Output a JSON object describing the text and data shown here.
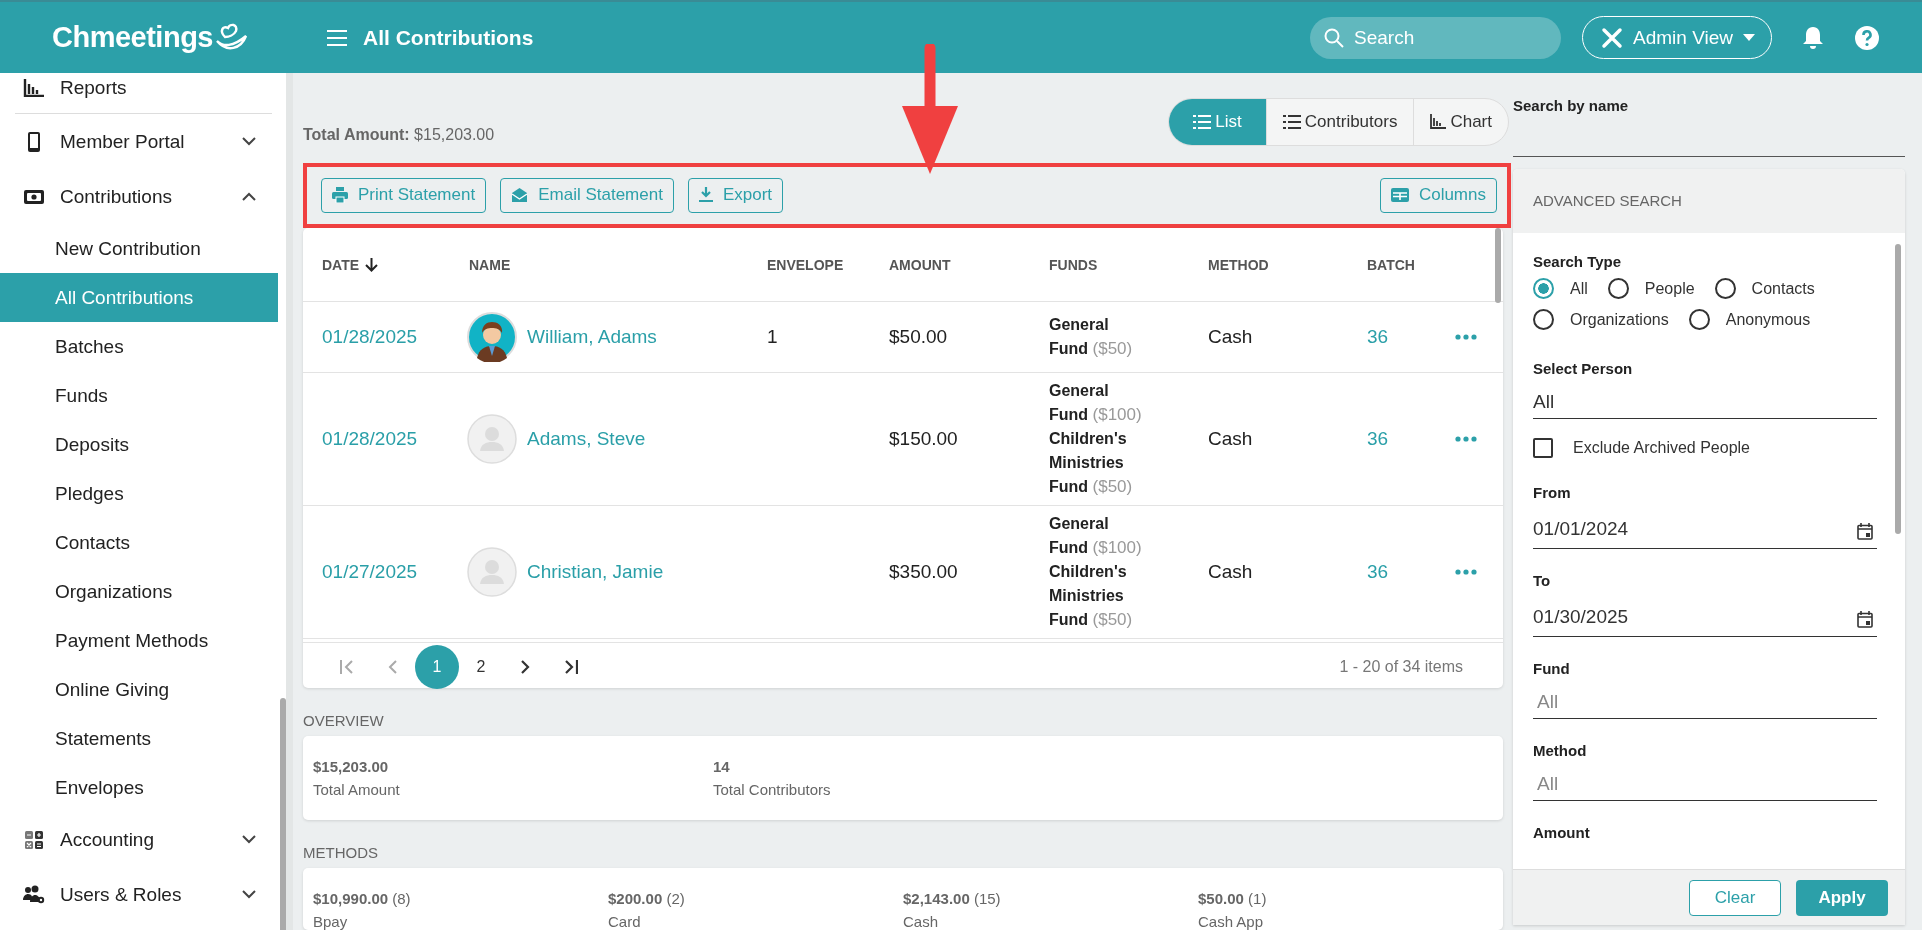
{
  "header": {
    "logo": "Chmeetings",
    "page_title": "All Contributions",
    "search": {
      "placeholder": "Search"
    },
    "view_button": "Admin View"
  },
  "sidebar": {
    "items": [
      {
        "label": "Reports"
      },
      {
        "label": "Member Portal",
        "expanded": false
      },
      {
        "label": "Contributions",
        "expanded": true,
        "children": [
          {
            "label": "New Contribution",
            "selected": false
          },
          {
            "label": "All Contributions",
            "selected": true
          },
          {
            "label": "Batches",
            "selected": false
          },
          {
            "label": "Funds",
            "selected": false
          },
          {
            "label": "Deposits",
            "selected": false
          },
          {
            "label": "Pledges",
            "selected": false
          },
          {
            "label": "Contacts",
            "selected": false
          },
          {
            "label": "Organizations",
            "selected": false
          },
          {
            "label": "Payment Methods",
            "selected": false
          },
          {
            "label": "Online Giving",
            "selected": false
          },
          {
            "label": "Statements",
            "selected": false
          },
          {
            "label": "Envelopes",
            "selected": false
          }
        ]
      },
      {
        "label": "Accounting",
        "expanded": false
      },
      {
        "label": "Users & Roles",
        "expanded": false
      }
    ]
  },
  "total_amount": {
    "label": "Total Amount:",
    "value": "$15,203.00"
  },
  "view_tabs": [
    {
      "label": "List",
      "selected": true
    },
    {
      "label": "Contributors",
      "selected": false
    },
    {
      "label": "Chart",
      "selected": false
    }
  ],
  "toolbar": {
    "buttons": [
      "Print Statement",
      "Email Statement",
      "Export"
    ],
    "columns_button": "Columns"
  },
  "table": {
    "columns": [
      {
        "label": "DATE",
        "sorted": true
      },
      {
        "label": "NAME",
        "sorted": false
      },
      {
        "label": "ENVELOPE",
        "sorted": false
      },
      {
        "label": "AMOUNT",
        "sorted": false
      },
      {
        "label": "FUNDS",
        "sorted": false
      },
      {
        "label": "METHOD",
        "sorted": false
      },
      {
        "label": "BATCH",
        "sorted": false
      }
    ],
    "rows": [
      {
        "date": "01/28/2025",
        "name": "William, Adams",
        "photo": true,
        "envelope": "1",
        "amount": "$50.00",
        "funds": [
          {
            "name": "General Fund",
            "amount": "($50)"
          }
        ],
        "method": "Cash",
        "batch": "36"
      },
      {
        "date": "01/28/2025",
        "name": "Adams, Steve",
        "photo": false,
        "amount": "$150.00",
        "funds": [
          {
            "name": "General Fund",
            "amount": "($100)"
          },
          {
            "name": "Children's Ministries Fund",
            "amount": "($50)"
          }
        ],
        "method": "Cash",
        "batch": "36"
      },
      {
        "date": "01/27/2025",
        "name": "Christian, Jamie",
        "photo": false,
        "amount": "$350.00",
        "funds": [
          {
            "name": "General Fund",
            "amount": "($100)"
          },
          {
            "name": "Children's Ministries Fund",
            "amount": "($50)"
          }
        ],
        "method": "Cash",
        "batch": "36"
      }
    ],
    "pagination": {
      "pages": [
        {
          "label": "1",
          "selected": true
        },
        {
          "label": "2",
          "selected": false
        }
      ],
      "summary": "1 - 20 of 34 items"
    }
  },
  "overview": {
    "title": "OVERVIEW",
    "stats": [
      {
        "value": "$15,203.00",
        "label": "Total Amount"
      },
      {
        "value": "14",
        "label": "Total Contributors"
      }
    ]
  },
  "methods": {
    "title": "METHODS",
    "items": [
      {
        "amount": "$10,990.00",
        "count": "(8)",
        "label": "Bpay"
      },
      {
        "amount": "$200.00",
        "count": "(2)",
        "label": "Card"
      },
      {
        "amount": "$2,143.00",
        "count": "(15)",
        "label": "Cash"
      },
      {
        "amount": "$50.00",
        "count": "(1)",
        "label": "Cash App"
      }
    ]
  },
  "search_by_name": {
    "label": "Search by name"
  },
  "advanced_search": {
    "title": "ADVANCED SEARCH",
    "search_type": {
      "label": "Search Type",
      "options": [
        {
          "label": "All",
          "selected": true
        },
        {
          "label": "People",
          "selected": false
        },
        {
          "label": "Contacts",
          "selected": false
        },
        {
          "label": "Organizations",
          "selected": false
        },
        {
          "label": "Anonymous",
          "selected": false
        }
      ]
    },
    "select_person": {
      "label": "Select Person",
      "value": "All"
    },
    "exclude_archived": {
      "label": "Exclude Archived People",
      "checked": false
    },
    "from": {
      "label": "From",
      "value": "01/01/2024"
    },
    "to": {
      "label": "To",
      "value": "01/30/2025"
    },
    "fund": {
      "label": "Fund",
      "placeholder": "All"
    },
    "method": {
      "label": "Method",
      "placeholder": "All"
    },
    "amount": {
      "label": "Amount"
    },
    "buttons": {
      "clear": "Clear",
      "apply": "Apply"
    }
  }
}
